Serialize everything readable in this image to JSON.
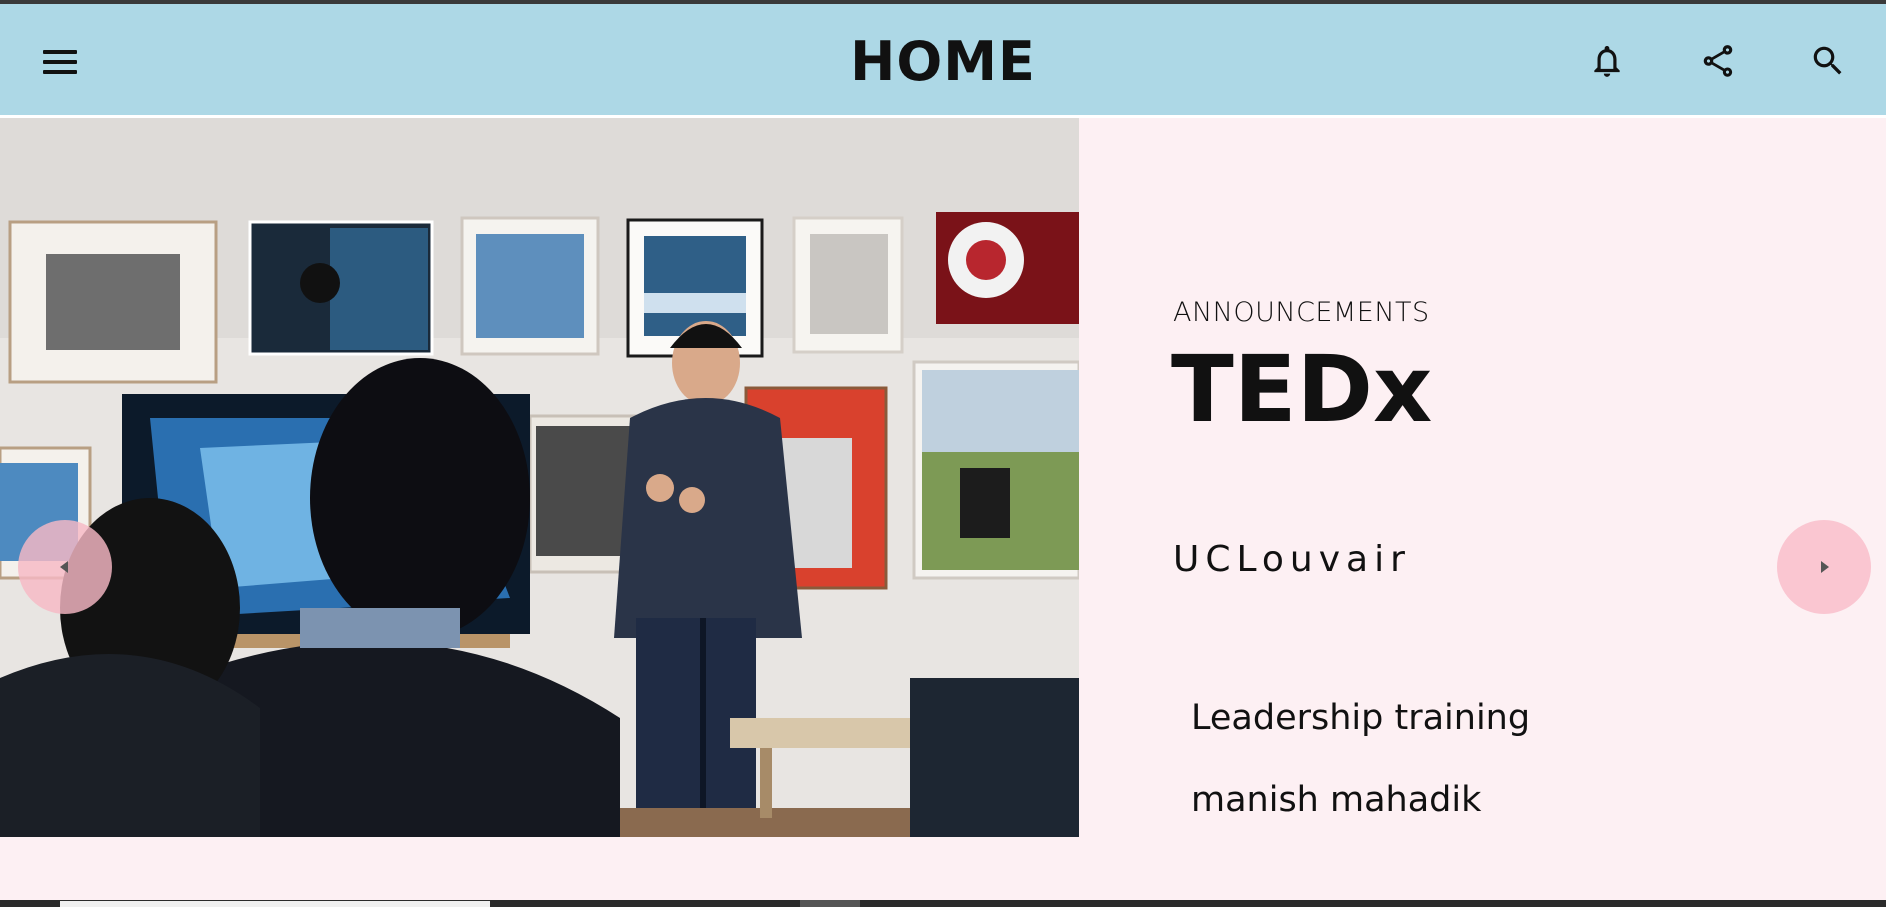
{
  "header": {
    "title": "HOME",
    "menu_icon": "hamburger-menu-icon",
    "actions": [
      {
        "icon": "bell-icon"
      },
      {
        "icon": "share-icon"
      },
      {
        "icon": "search-icon"
      }
    ],
    "background": "#add8e6"
  },
  "slide": {
    "image": "presenter-in-gallery-photo",
    "eyebrow": "ANNOUNCEMENTS",
    "headline": "TEDx",
    "organization": "UCLouvair",
    "items": [
      {
        "label": "Leadership training"
      },
      {
        "label": "manish mahadik"
      }
    ],
    "panel_background": "#fdf0f3"
  },
  "carousel": {
    "prev_icon": "caret-left-icon",
    "next_icon": "caret-right-icon",
    "button_color": "#f8c3ce"
  }
}
